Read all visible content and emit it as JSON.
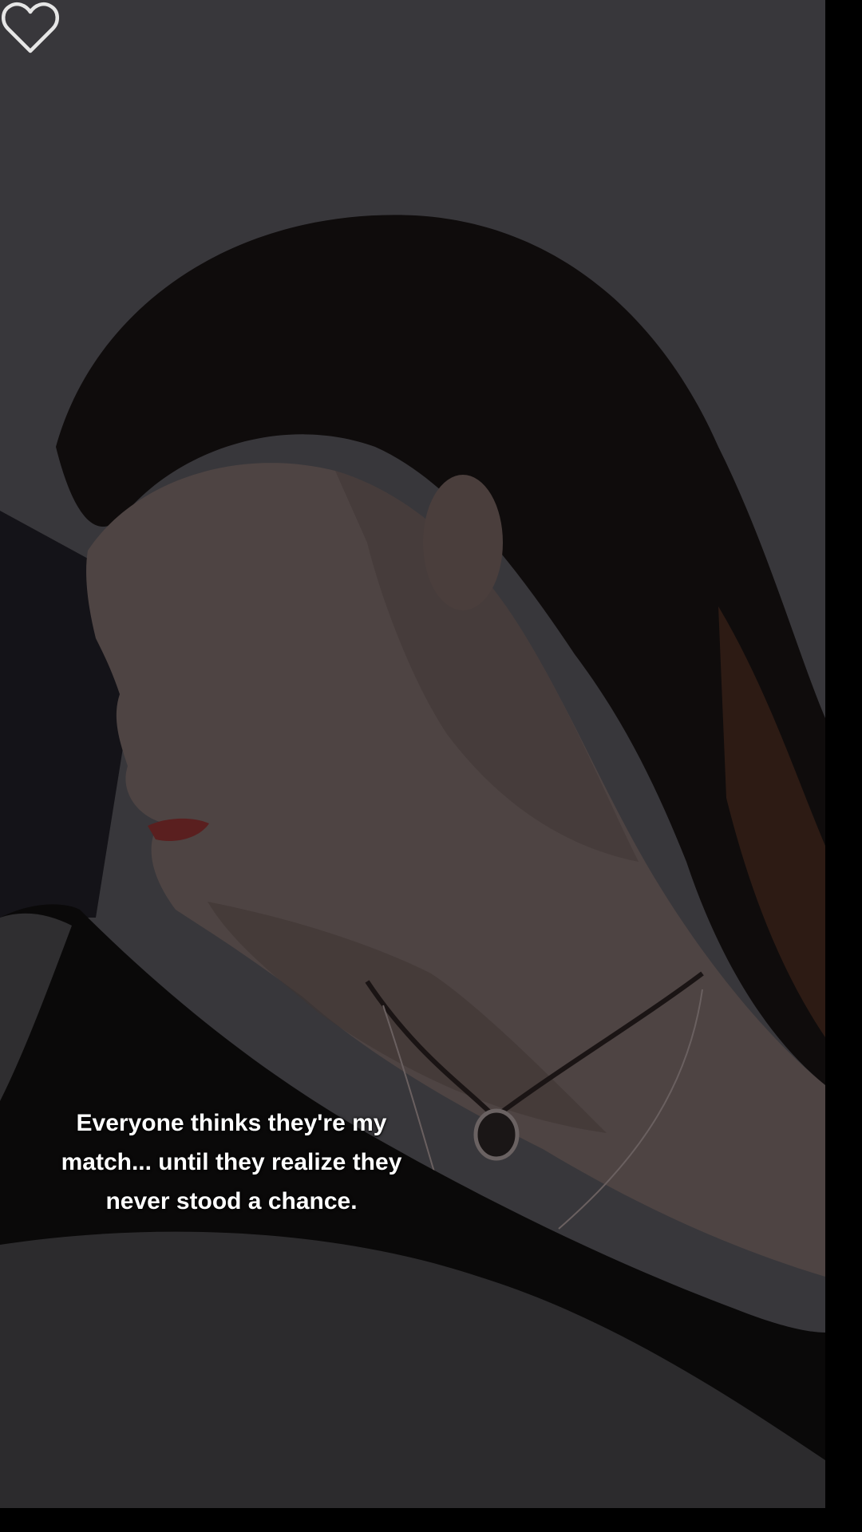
{
  "post": {
    "caption": "Everyone thinks they're my match... until they realize they never stood a chance."
  },
  "icons": {
    "like": "heart-outline-icon"
  },
  "colors": {
    "background": "#000000",
    "caption_text": "#ffffff",
    "heart_outline": "#e6e6e6"
  }
}
